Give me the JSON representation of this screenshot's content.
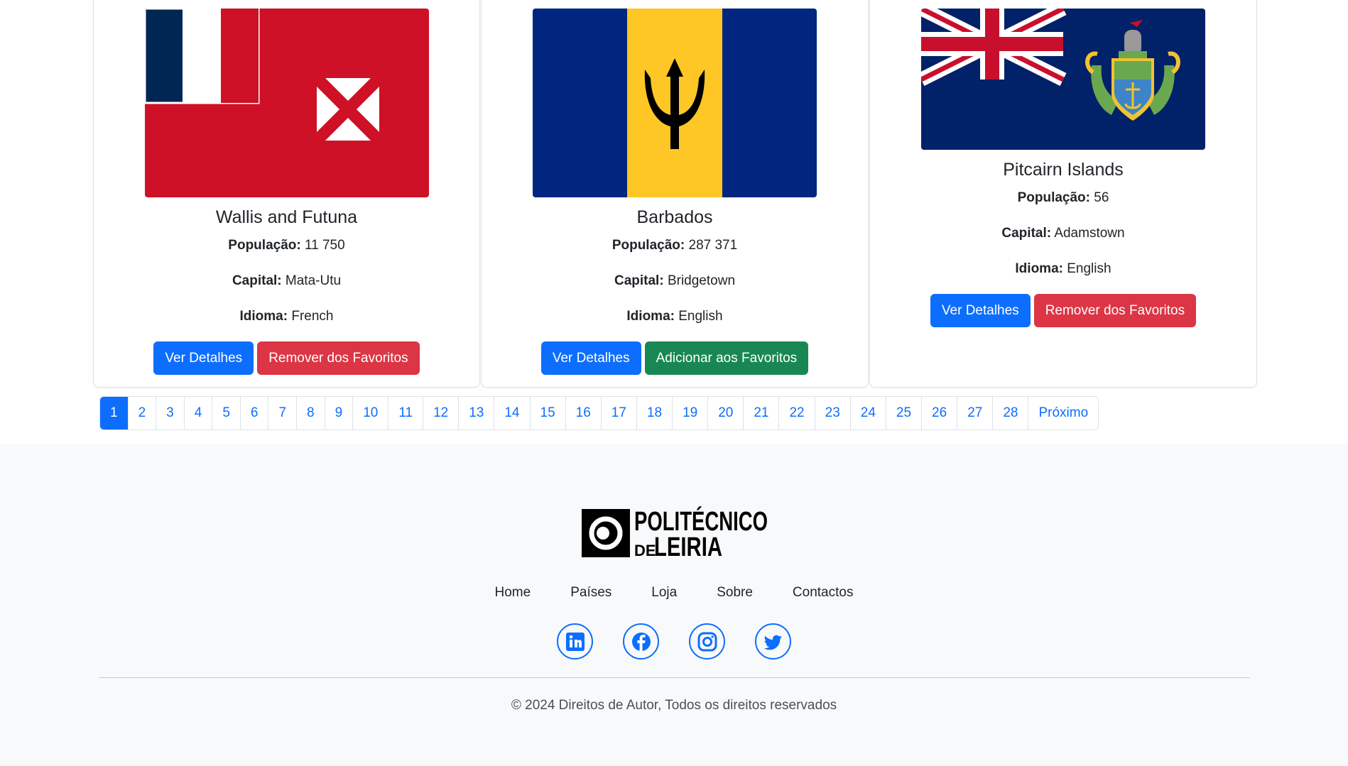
{
  "countries": [
    {
      "name": "Wallis and Futuna",
      "population_label": "População:",
      "population": "11 750",
      "capital_label": "Capital:",
      "capital": "Mata-Utu",
      "language_label": "Idioma:",
      "language": "French",
      "details_button": "Ver Detalhes",
      "favorite_button": "Remover dos Favoritos",
      "favorite_state": "favorited"
    },
    {
      "name": "Barbados",
      "population_label": "População:",
      "population": "287 371",
      "capital_label": "Capital:",
      "capital": "Bridgetown",
      "language_label": "Idioma:",
      "language": "English",
      "details_button": "Ver Detalhes",
      "favorite_button": "Adicionar aos Favoritos",
      "favorite_state": "not-favorited"
    },
    {
      "name": "Pitcairn Islands",
      "population_label": "População:",
      "population": "56",
      "capital_label": "Capital:",
      "capital": "Adamstown",
      "language_label": "Idioma:",
      "language": "English",
      "details_button": "Ver Detalhes",
      "favorite_button": "Remover dos Favoritos",
      "favorite_state": "favorited"
    }
  ],
  "pagination": {
    "pages": [
      "1",
      "2",
      "3",
      "4",
      "5",
      "6",
      "7",
      "8",
      "9",
      "10",
      "11",
      "12",
      "13",
      "14",
      "15",
      "16",
      "17",
      "18",
      "19",
      "20",
      "21",
      "22",
      "23",
      "24",
      "25",
      "26",
      "27",
      "28"
    ],
    "active_page": "1",
    "next_label": "Próximo"
  },
  "footer": {
    "logo_text_line1": "POLITÉCNICO",
    "logo_text_line2_small": "DE",
    "logo_text_line2": "LEIRIA",
    "nav": [
      "Home",
      "Países",
      "Loja",
      "Sobre",
      "Contactos"
    ],
    "social_icons": [
      "linkedin-icon",
      "facebook-icon",
      "instagram-icon",
      "twitter-icon"
    ],
    "copyright": "© 2024 Direitos de Autor, Todos os direitos reservados"
  },
  "colors": {
    "primary": "#0d6efd",
    "danger": "#dc3545",
    "success": "#198754",
    "footer_bg": "#f8f9fa"
  }
}
